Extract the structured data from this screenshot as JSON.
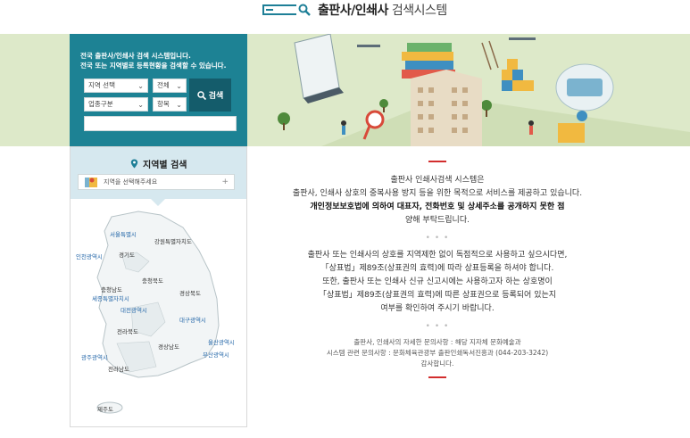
{
  "header": {
    "title_bold": "출판사/인쇄사",
    "title_light": " 검색시스템"
  },
  "search_panel": {
    "intro_line1": "전국 출판사/인쇄사 검색 시스템입니다.",
    "intro_line2": "전국 또는 지역별로 등록현황을 검색할 수 있습니다.",
    "region_select": "지역 선택",
    "district_select": "전체",
    "business_type_select": "업종구분",
    "field_select": "항목",
    "search_button": "검색",
    "keyword_value": ""
  },
  "region_search": {
    "title": "지역별 검색",
    "select_placeholder": "지역을 선택해주세요",
    "regions": [
      "서울특별시",
      "강원특별자치도",
      "인천광역시",
      "경기도",
      "충청북도",
      "충청남도",
      "세종특별자치시",
      "대전광역시",
      "경상북도",
      "대구광역시",
      "전라북도",
      "울산광역시",
      "경상남도",
      "부산광역시",
      "광주광역시",
      "전라남도",
      "제주도"
    ]
  },
  "notice": {
    "title": "출판사 인쇄사검색 시스템은",
    "line1": "출판사, 인쇄사 상호의 중복사용 방지 등을 위한 목적으로 서비스를 제공하고 있습니다.",
    "line2_bold": "개인정보보호법에 의하여 대표자, 전화번호 및 상세주소를 공개하지 못한 점",
    "line3": "양해 부탁드립니다.",
    "dots": "• • •",
    "para2_line1": "출판사 또는 인쇄사의 상호를 지역제한 없이 독점적으로 사용하고 싶으시다면,",
    "para2_line2": "「상표법」제89조(상표권의 효력)에 따라 상표등록을 하셔야 합니다.",
    "para2_line3": "또한, 출판사 또는 인쇄사 신규 신고시에는 사용하고자 하는 상호명이",
    "para2_line4": "「상표법」제89조(상표권의 효력)에 따른 상표권으로 등록되어 있는지",
    "para2_line5": "여부를 확인하여 주시기 바랍니다.",
    "contact1": "출판사, 인쇄사의 자세한 문의사항 : 해당 지자체 문화예술과",
    "contact2": "시스템 관련 문의사항 : 문화체육관광부 출판인쇄독서진흥과 (044-203-3242)",
    "thanks": "감사합니다."
  },
  "colors": {
    "panel": "#1d8294",
    "button": "#145c6b",
    "banner": "#dde9c9",
    "accent_red": "#d22d2d"
  }
}
